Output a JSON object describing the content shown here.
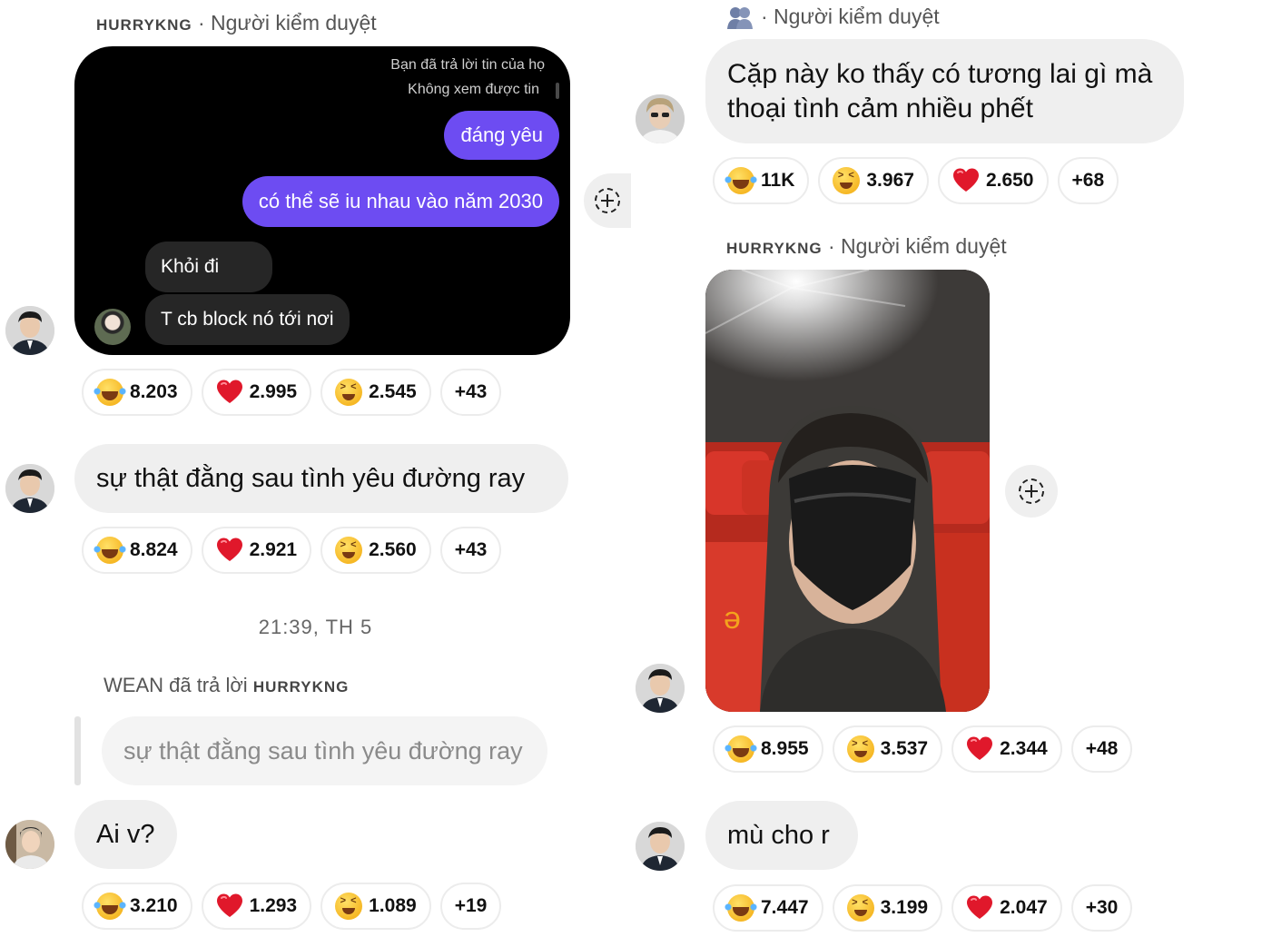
{
  "left": {
    "post1": {
      "sender_name": "HURRYKNG",
      "sender_role": "· Người kiểm duyệt",
      "screenshot": {
        "reply_meta_1": "Bạn đã trả lời tin của họ",
        "reply_meta_2": "Không xem được tin",
        "sent_1": "đáng yêu",
        "sent_2": "có thể sẽ iu nhau vào năm 2030",
        "recv_1": "Khỏi đi",
        "recv_2": "T cb block nó tới nơi"
      },
      "reactions": [
        {
          "icon": "laugh-cry-emoji",
          "count": "8.203"
        },
        {
          "icon": "heart-emoji",
          "count": "2.995"
        },
        {
          "icon": "squint-laugh-emoji",
          "count": "2.545"
        },
        {
          "icon": "",
          "count": "+43"
        }
      ]
    },
    "post2": {
      "text": "sự thật đằng sau tình yêu đường ray",
      "reactions": [
        {
          "icon": "laugh-cry-emoji",
          "count": "8.824"
        },
        {
          "icon": "heart-emoji",
          "count": "2.921"
        },
        {
          "icon": "squint-laugh-emoji",
          "count": "2.560"
        },
        {
          "icon": "",
          "count": "+43"
        }
      ]
    },
    "timestamp": "21:39, TH 5",
    "reply": {
      "replier": "WEAN đã trả lời",
      "replied_to": "HURRYKNG",
      "quoted_text": "sự thật đằng sau tình yêu đường ray"
    },
    "post3": {
      "text": "Ai v?",
      "reactions": [
        {
          "icon": "laugh-cry-emoji",
          "count": "3.210"
        },
        {
          "icon": "heart-emoji",
          "count": "1.293"
        },
        {
          "icon": "squint-laugh-emoji",
          "count": "1.089"
        },
        {
          "icon": "",
          "count": "+19"
        }
      ]
    }
  },
  "right": {
    "post1": {
      "sender_role": "· Người kiểm duyệt",
      "text_line1": "Cặp này ko thấy có tương lai gì mà",
      "text_line2": "thoại tình cảm nhiều phết",
      "reactions": [
        {
          "icon": "laugh-cry-emoji",
          "count": "11K"
        },
        {
          "icon": "squint-laugh-emoji",
          "count": "3.967"
        },
        {
          "icon": "heart-emoji",
          "count": "2.650"
        },
        {
          "icon": "",
          "count": "+68"
        }
      ]
    },
    "post2": {
      "sender_name": "HURRYKNG",
      "sender_role": "· Người kiểm duyệt",
      "photo_caption_glyph": "ə",
      "reactions": [
        {
          "icon": "laugh-cry-emoji",
          "count": "8.955"
        },
        {
          "icon": "squint-laugh-emoji",
          "count": "3.537"
        },
        {
          "icon": "heart-emoji",
          "count": "2.344"
        },
        {
          "icon": "",
          "count": "+48"
        }
      ]
    },
    "post3": {
      "text": "mù cho r",
      "reactions": [
        {
          "icon": "laugh-cry-emoji",
          "count": "7.447"
        },
        {
          "icon": "squint-laugh-emoji",
          "count": "3.199"
        },
        {
          "icon": "heart-emoji",
          "count": "2.047"
        },
        {
          "icon": "",
          "count": "+30"
        }
      ]
    }
  },
  "colors": {
    "bubble": "#efefef",
    "sent_bubble": "#6d4cf2",
    "dark_bg": "#000000",
    "heart": "#e0182b"
  }
}
